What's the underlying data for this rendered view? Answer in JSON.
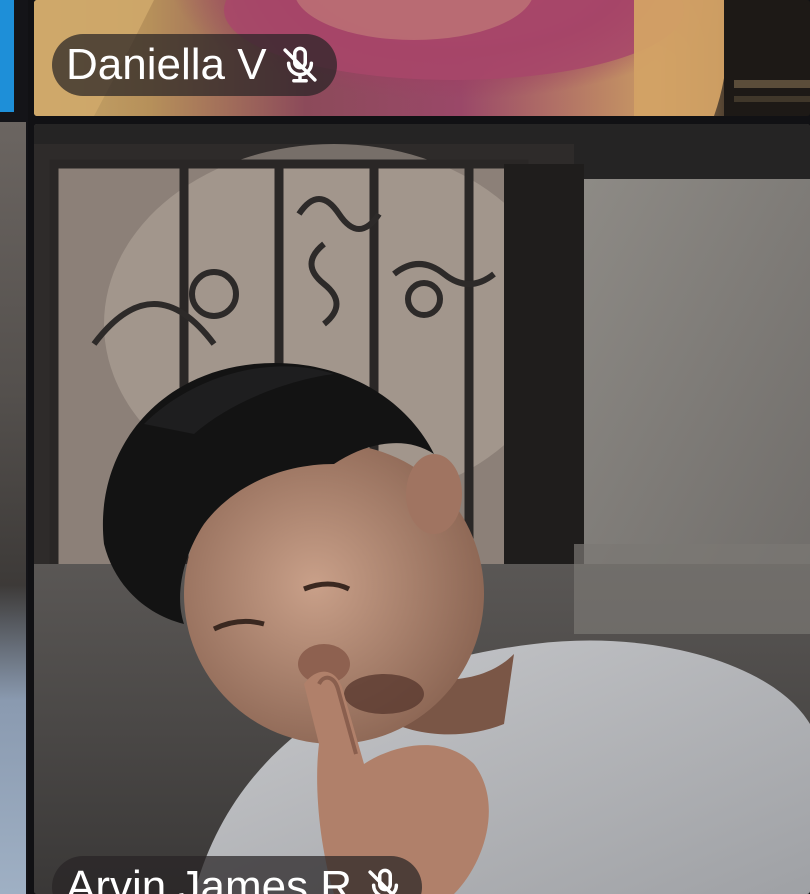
{
  "participants": [
    {
      "name": "Daniella V",
      "muted": true,
      "icon": "mic-off-icon"
    },
    {
      "name": "Arvin James R",
      "muted": true,
      "icon": "mic-off-icon"
    }
  ],
  "colors": {
    "pill_background": "rgba(40,36,38,0.72)",
    "label_text": "#ffffff",
    "left_accent": "#1e8fd8"
  }
}
